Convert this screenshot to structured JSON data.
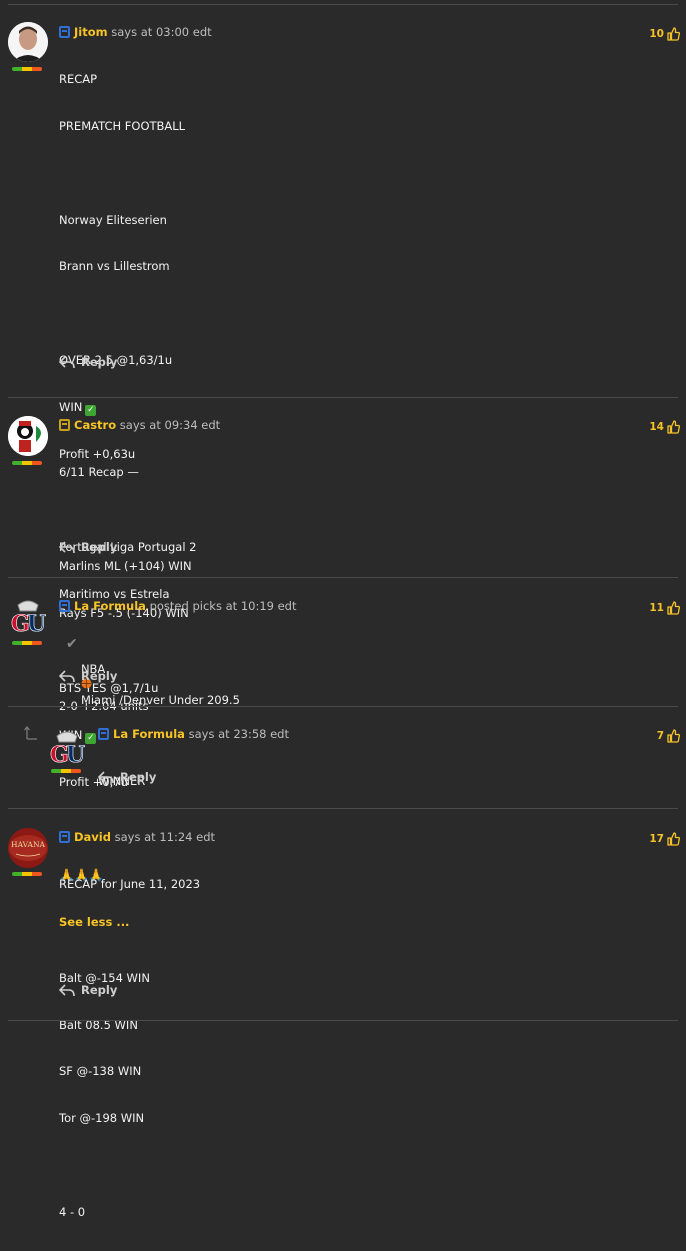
{
  "comments": [
    {
      "author": "Jitom",
      "action": "says at",
      "time": "03:00 edt",
      "likes": "10",
      "lines": [
        "RECAP",
        "PREMATCH FOOTBALL",
        "",
        "Norway Eliteserien",
        "Brann vs Lillestrom",
        "",
        "OVER 2,5 @1,63/1u",
        "WIN",
        "Profit +0,63u",
        "",
        "Portugal Liga Portugal 2",
        "Maritimo vs Estrela",
        "",
        "BTS YES @1,7/1u",
        "WIN",
        "Profit +0,7u",
        ""
      ],
      "emoji": "🙏🙏🙏",
      "see_less": "See less ...",
      "reply": "Reply",
      "badge_color": "#2f6fd6"
    },
    {
      "author": "Castro",
      "action": "says at",
      "time": "09:34 edt",
      "likes": "14",
      "lines": [
        "6/11 Recap —",
        "",
        "Marlins ML (+104) WIN",
        "Rays F5 -.5 (-140) WIN",
        "",
        "2-0 +2.04 units"
      ],
      "reply": "Reply",
      "badge_color": "#c8a21b"
    },
    {
      "author": "La Formula",
      "action": "posted picks at",
      "time": "10:19 edt",
      "likes": "11",
      "line_prefix": "NBA",
      "line_suffix": "Miami /Denver Under 209.5",
      "reply": "Reply",
      "badge_color": "#2f6fd6"
    },
    {
      "author": "La Formula",
      "action": "says at",
      "time": "23:58 edt",
      "likes": "7",
      "lines": [
        "WINNER"
      ],
      "reply": "Reply",
      "badge_color": "#2f6fd6"
    },
    {
      "author": "David",
      "action": "says at",
      "time": "11:24 edt",
      "likes": "17",
      "lines": [
        "RECAP for June 11, 2023",
        "",
        "Balt @-154 WIN",
        "Balt 08.5 WIN",
        "SF @-138 WIN",
        "Tor @-198 WIN",
        "",
        "4 - 0"
      ],
      "reply": "Reply",
      "badge_color": "#2f6fd6",
      "avatar_text": "HAVANA"
    }
  ],
  "colors": {
    "accent": "#f7c325",
    "background": "#2a2a2a",
    "divider": "#4a4a4a"
  }
}
